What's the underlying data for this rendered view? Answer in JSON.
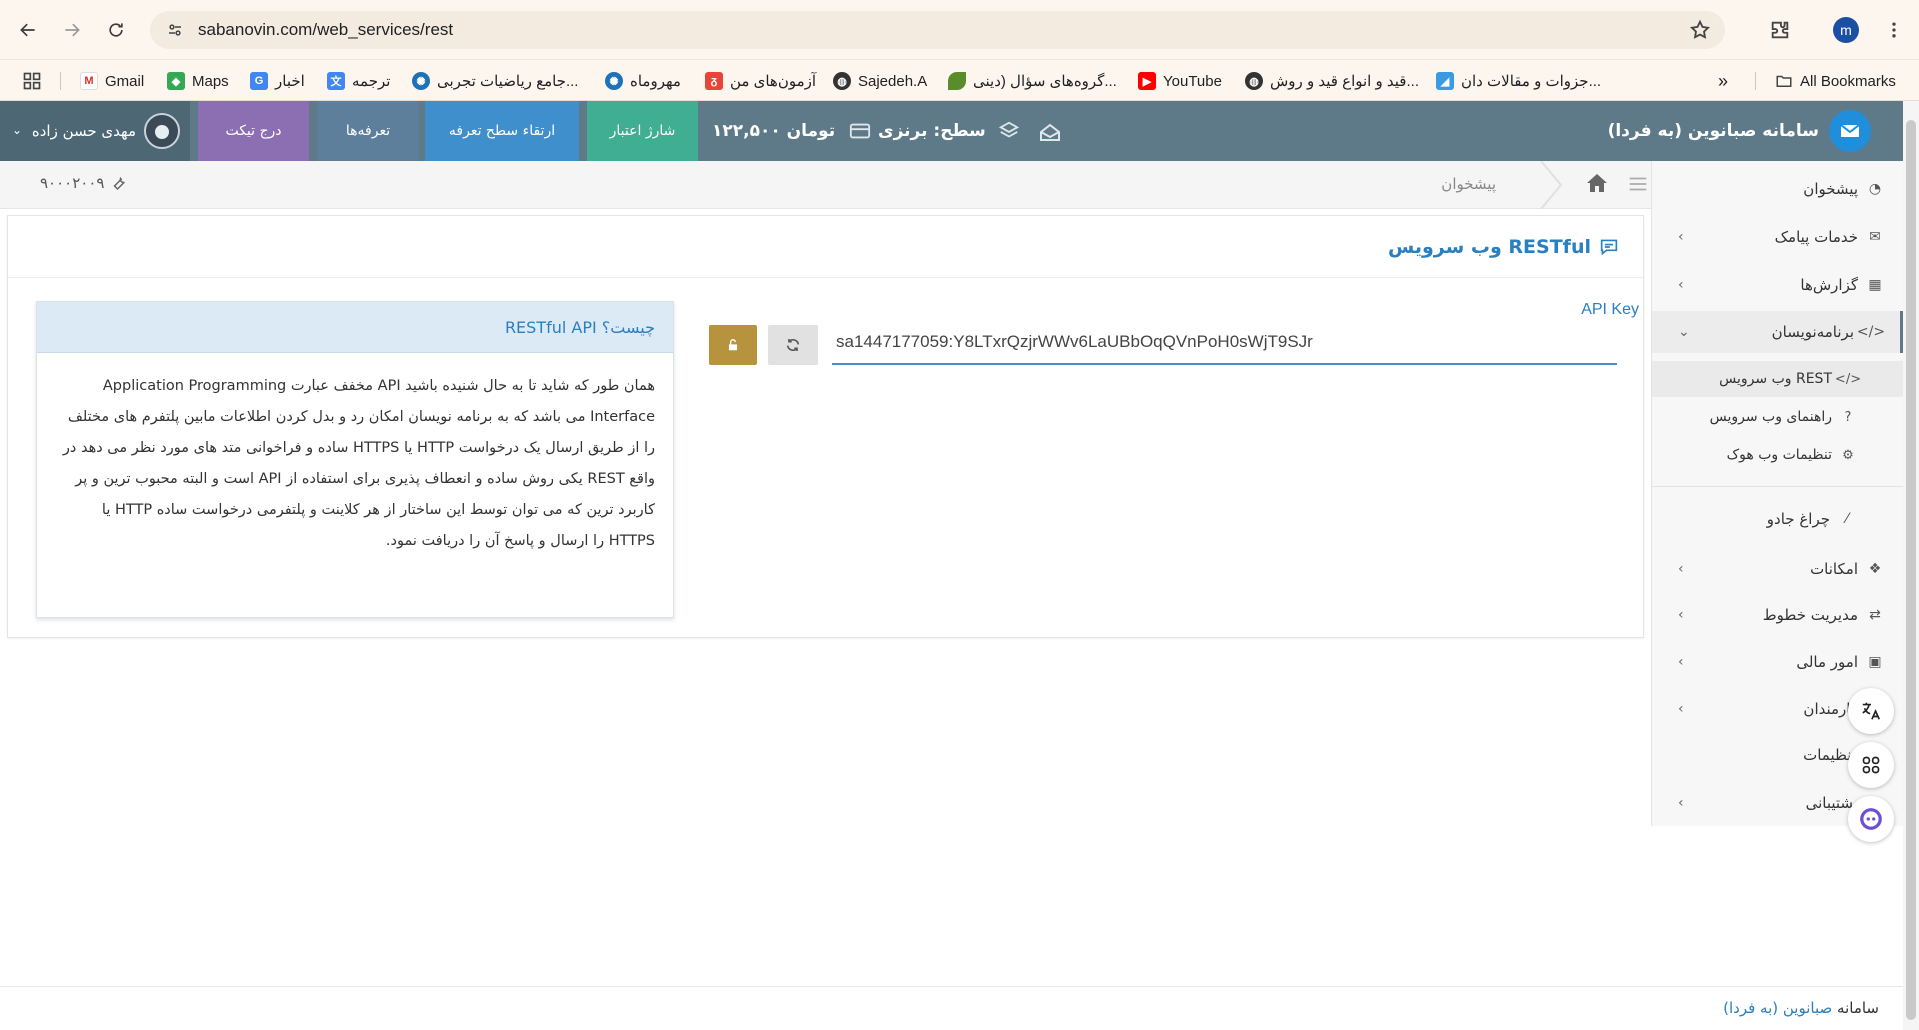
{
  "browser": {
    "url": "sabanovin.com/web_services/rest",
    "profile_initial": "m",
    "bookmarks": [
      {
        "label": "Gmail",
        "icon": "gmail-icon"
      },
      {
        "label": "Maps",
        "icon": "maps-icon"
      },
      {
        "label": "اخبار",
        "icon": "news-icon"
      },
      {
        "label": "ترجمه",
        "icon": "translate-icon"
      },
      {
        "label": "جامع ریاضیات تجربی...",
        "icon": "site-icon"
      },
      {
        "label": "مهروماه",
        "icon": "site-icon"
      },
      {
        "label": "آزمون‌های من",
        "icon": "site-icon"
      },
      {
        "label": "Sajedeh.A",
        "icon": "globe-icon"
      },
      {
        "label": "گروه‌های سؤال (دینی...",
        "icon": "leaf-icon"
      },
      {
        "label": "YouTube",
        "icon": "youtube-icon"
      },
      {
        "label": "قید و انواع قید و روش...",
        "icon": "globe-icon"
      },
      {
        "label": "جزوات و مقالات دان...",
        "icon": "site-icon"
      }
    ],
    "all_bookmarks": "All Bookmarks"
  },
  "header": {
    "brand": "سامانه صبانوین (به فردا)",
    "level": "سطح: برنزی",
    "balance": "۱۲۲,۵۰۰ تومان",
    "buttons": {
      "charge": "شارژ اعتبار",
      "upgrade": "ارتقاء سطح تعرفه",
      "tariffs": "تعرفه‌ها",
      "ticket": "درج تیکت"
    },
    "user_name": "مهدی حسن زاده",
    "colors": {
      "charge": "#3fae93",
      "upgrade": "#3f8fcd",
      "tariffs": "#5d7f9b",
      "ticket": "#8b6fb2"
    }
  },
  "breadcrumb": {
    "current": "پیشخوان",
    "phone": "۹۰۰۰۲۰۰۹"
  },
  "sidebar": {
    "items": [
      {
        "label": "پیشخوان"
      },
      {
        "label": "خدمات پیامک"
      },
      {
        "label": "گزارش‌ها"
      },
      {
        "label": "برنامه‌نویسان"
      },
      {
        "label": "چراغ جادو"
      },
      {
        "label": "امکانات"
      },
      {
        "label": "مدیریت خطوط"
      },
      {
        "label": "امور مالی"
      },
      {
        "label": "کارمندان"
      },
      {
        "label": "تنظیمات"
      },
      {
        "label": "پشتیبانی"
      }
    ],
    "sub_items": [
      {
        "label": "وب سرویس REST"
      },
      {
        "label": "راهنمای وب سرویس"
      },
      {
        "label": "تنظیمات وب هوک"
      }
    ]
  },
  "main": {
    "title": "وب سرویس RESTful",
    "api_key_label": "API Key",
    "api_key_value": "sa1447177059:Y8LTxrQzjrWWv6LaUBbOqQVnPoH0sWjT9SJr",
    "info_title": "RESTful API چیست؟",
    "info_text": "همان طور که شاید تا به حال شنیده باشید API مخفف عبارت Application Programming Interface می باشد که به برنامه نویسان امکان رد و بدل کردن اطلاعات مابین پلتفرم های مختلف را از طریق ارسال یک درخواست HTTP یا HTTPS ساده و فراخوانی متد های مورد نظر می دهد در واقع REST یکی روش ساده و انعطاف پذیری برای استفاده از API است و البته محبوب ترین و پر کاربرد ترین که می توان توسط این ساختار از هر کلاینت و پلتفرمی درخواست ساده HTTP یا HTTPS را ارسال و پاسخ آن را دریافت نمود."
  },
  "footer": {
    "prefix": "سامانه",
    "link": "صبانوین (به فردا)"
  }
}
